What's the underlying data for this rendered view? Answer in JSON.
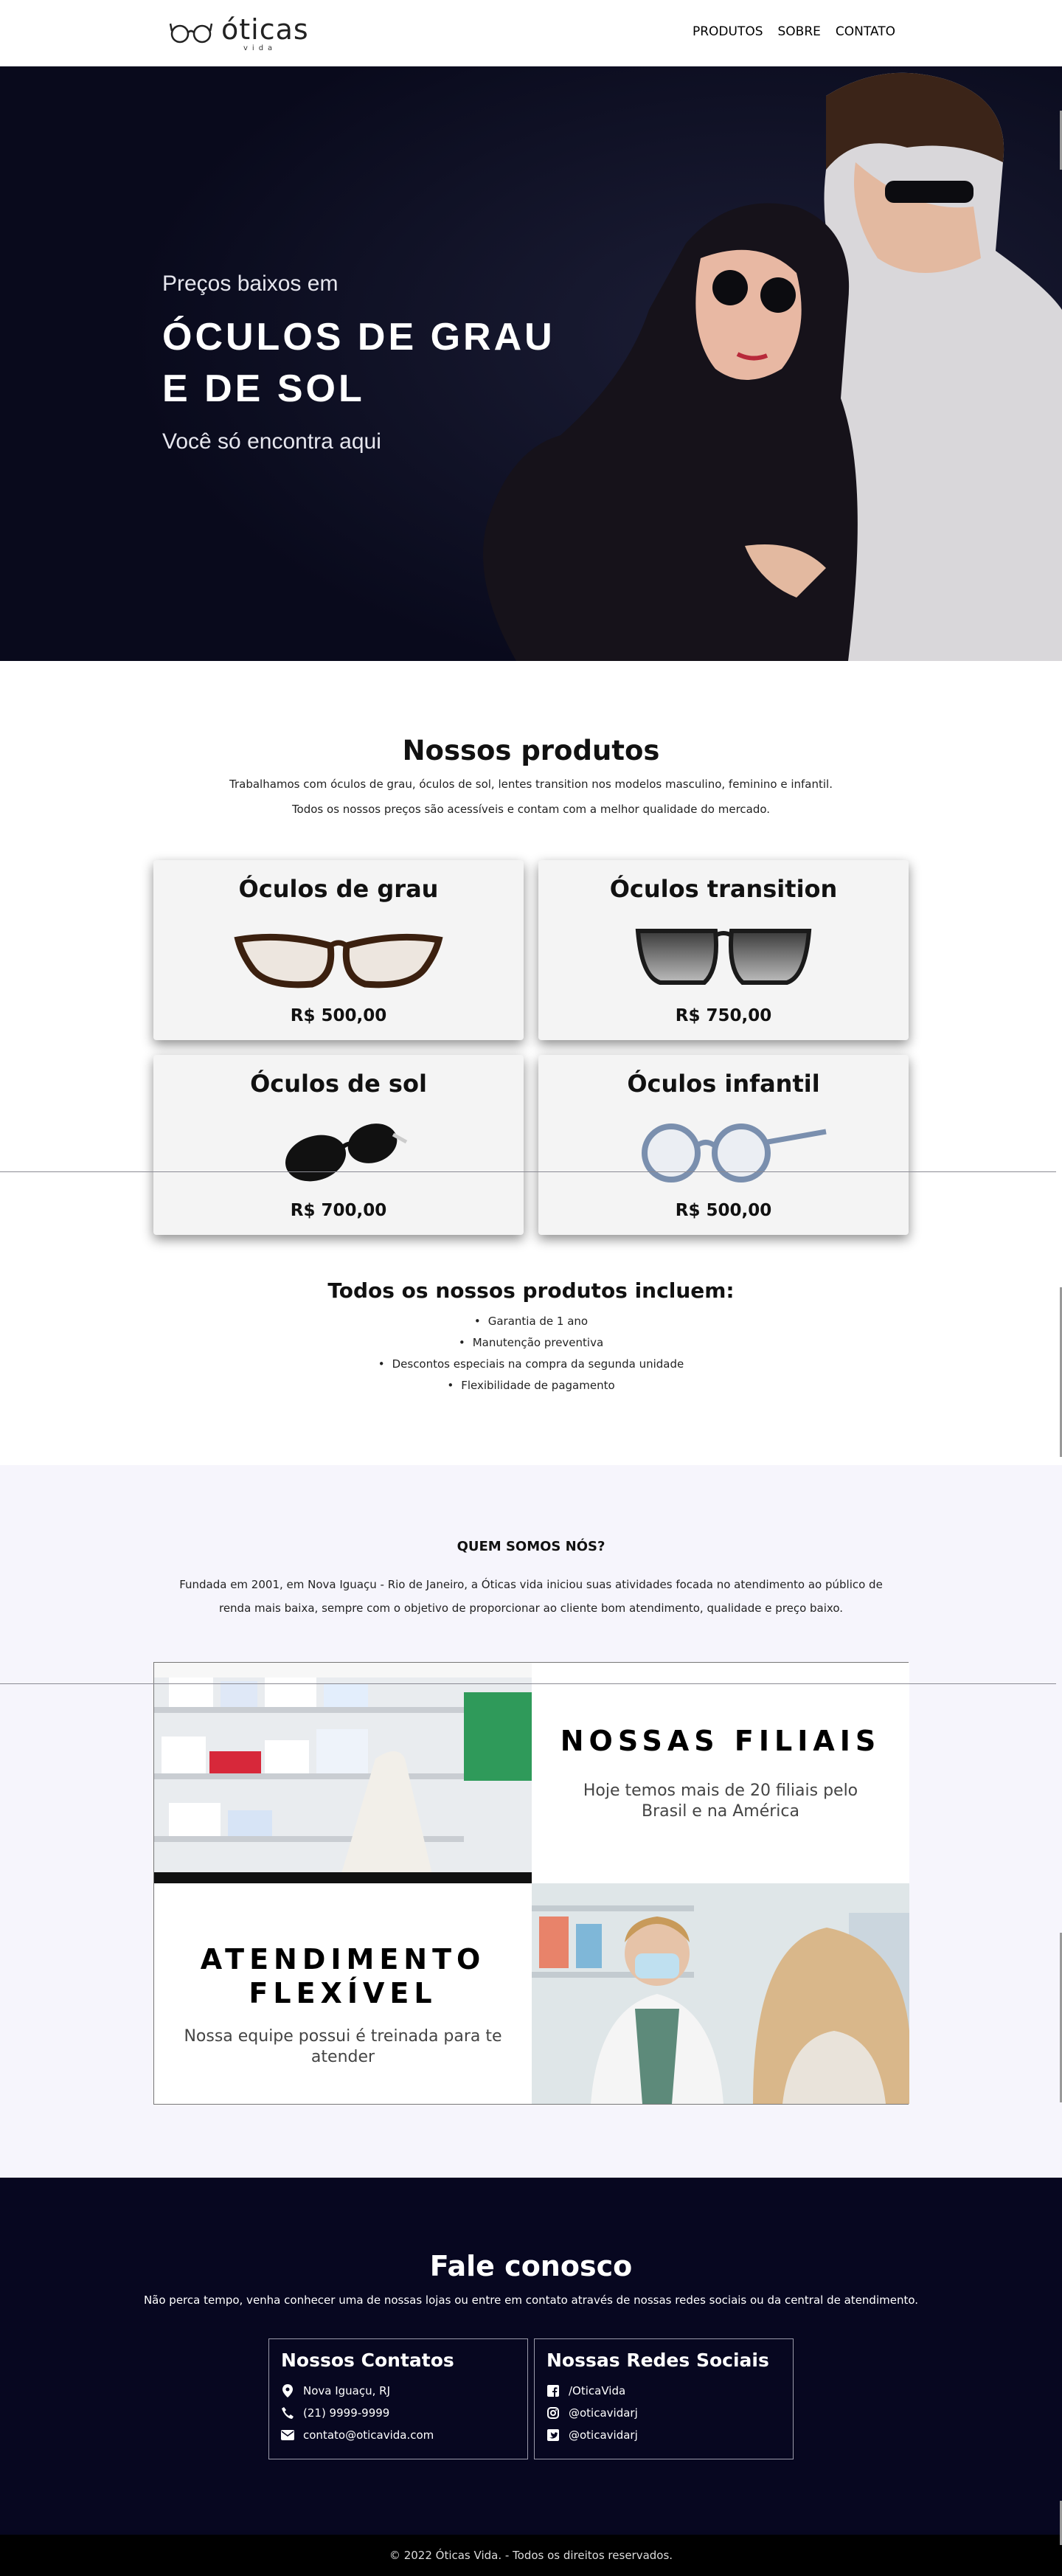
{
  "header": {
    "logo_word": "óticas",
    "logo_sub": "vida",
    "nav": [
      "PRODUTOS",
      "SOBRE",
      "CONTATO"
    ]
  },
  "hero": {
    "kicker": "Preços baixos em",
    "title": "ÓCULOS DE GRAU E DE SOL",
    "tagline": "Você só encontra aqui"
  },
  "products": {
    "title": "Nossos produtos",
    "lines": [
      "Trabalhamos com óculos de grau, óculos de sol, lentes transition nos modelos masculino, feminino e infantil.",
      "Todos os nossos preços são acessíveis e contam com a melhor qualidade do mercado."
    ],
    "cards": [
      {
        "name": "Óculos de grau",
        "price": "R$ 500,00",
        "icon": "cat-eye-glasses-icon"
      },
      {
        "name": "Óculos transition",
        "price": "R$ 750,00",
        "icon": "transition-glasses-icon"
      },
      {
        "name": "Óculos de sol",
        "price": "R$ 700,00",
        "icon": "sunglasses-icon"
      },
      {
        "name": "Óculos infantil",
        "price": "R$ 500,00",
        "icon": "kids-glasses-icon"
      }
    ],
    "includes_title": "Todos os nossos produtos incluem:",
    "includes": [
      "Garantia de 1 ano",
      "Manutenção preventiva",
      "Descontos especiais na compra da segunda unidade",
      "Flexibilidade de pagamento"
    ]
  },
  "about": {
    "title": "QUEM SOMOS NÓS?",
    "text": "Fundada em 2001, em Nova Iguaçu - Rio de Janeiro, a Óticas vida iniciou suas atividades focada no atendimento ao público de renda mais baixa, sempre com o objetivo de proporcionar ao cliente bom atendimento, qualidade e preço baixo.",
    "branches_title": "NOSSAS FILIAIS",
    "branches_text": "Hoje temos mais de 20 filiais pelo Brasil e na América",
    "service_title": "ATENDIMENTO FLEXÍVEL",
    "service_text": "Nossa equipe possui é treinada para te atender"
  },
  "footer": {
    "title": "Fale conosco",
    "text": "Não perca tempo, venha conhecer uma de nossas lojas ou entre em contato através de nossas redes sociais ou da central de atendimento.",
    "contacts_title": "Nossos Contatos",
    "contacts": [
      {
        "icon": "map-pin-icon",
        "text": "Nova Iguaçu, RJ"
      },
      {
        "icon": "phone-icon",
        "text": "(21) 9999-9999"
      },
      {
        "icon": "envelope-icon",
        "text": "contato@oticavida.com"
      }
    ],
    "social_title": "Nossas Redes Sociais",
    "social": [
      {
        "icon": "facebook-icon",
        "text": "/OticaVida"
      },
      {
        "icon": "instagram-icon",
        "text": "@oticavidarj"
      },
      {
        "icon": "twitter-icon",
        "text": "@oticavidarj"
      }
    ],
    "copyright": "© 2022 Óticas Vida. - Todos os direitos reservados."
  },
  "colors": {
    "hero_bg": "#0b0c22",
    "footer_bg": "#070720",
    "about_bg": "#f6f5fc",
    "card_bg": "#f4f4f4"
  }
}
